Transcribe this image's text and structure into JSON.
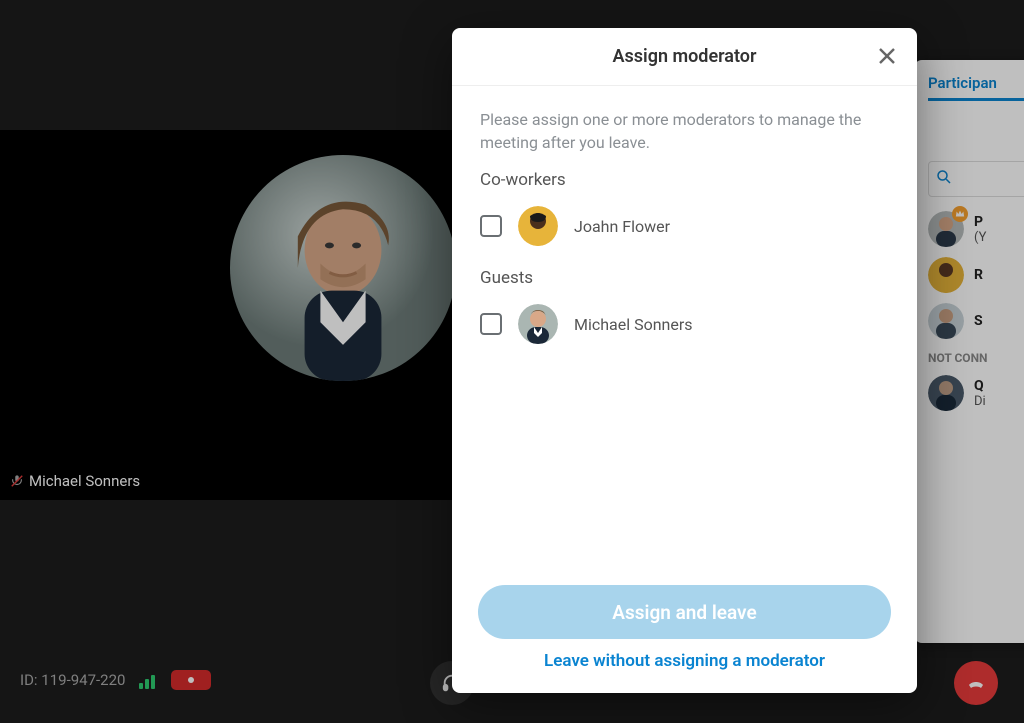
{
  "video": {
    "overlay_name": "Michael Sonners"
  },
  "bottom_bar": {
    "meeting_id_label": "ID: 119-947-220"
  },
  "side_panel": {
    "tab_label": "Participan",
    "items": [
      {
        "name_short": "P",
        "sub": "(Y"
      },
      {
        "name_short": "R",
        "sub": ""
      },
      {
        "name_short": "S",
        "sub": ""
      }
    ],
    "section_not_connected": "NOT CONN",
    "disconnected": {
      "name_short": "Q",
      "sub": "Di"
    }
  },
  "modal": {
    "title": "Assign moderator",
    "description": "Please assign one or more moderators to manage the meeting after you leave.",
    "group_coworkers": "Co-workers",
    "group_guests": "Guests",
    "coworkers": [
      {
        "name": "Joahn Flower"
      }
    ],
    "guests": [
      {
        "name": "Michael Sonners"
      }
    ],
    "primary_button": "Assign and leave",
    "link_button": "Leave without assigning a moderator"
  }
}
